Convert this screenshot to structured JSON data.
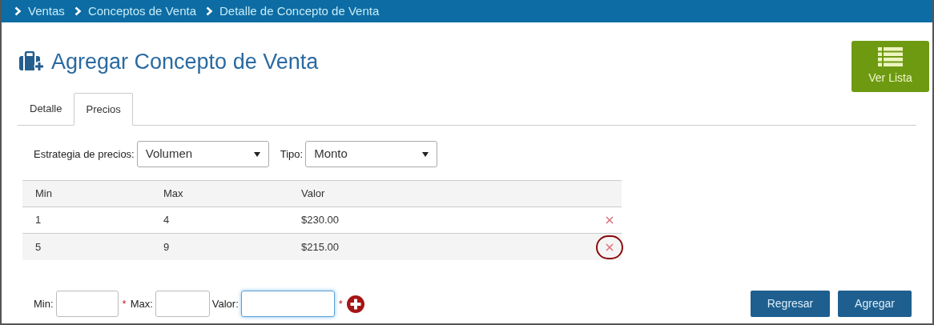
{
  "breadcrumb": [
    "Ventas",
    "Conceptos de Venta",
    "Detalle de Concepto de Venta"
  ],
  "title": "Agregar Concepto de Venta",
  "list_button": "Ver Lista",
  "tabs": [
    {
      "label": "Detalle",
      "selected": false
    },
    {
      "label": "Precios",
      "selected": true
    }
  ],
  "filters": [
    {
      "label": "Estrategia de precios:",
      "value": "Volumen"
    },
    {
      "label": "Tipo:",
      "value": "Monto"
    }
  ],
  "table": {
    "columns": [
      "Min",
      "Max",
      "Valor"
    ],
    "rows": [
      {
        "cells": [
          "1",
          "4",
          "$230.00"
        ],
        "highlighted": false
      },
      {
        "cells": [
          "5",
          "9",
          "$215.00"
        ],
        "highlighted": true
      }
    ]
  },
  "form": [
    {
      "label": "Min:",
      "required_mark": "*",
      "focused": false
    },
    {
      "label": "Max:",
      "focused": false
    },
    {
      "label": "Valor:",
      "required_mark": "*",
      "focused": true
    }
  ],
  "buttons": [
    "Regresar",
    "Agregar"
  ]
}
